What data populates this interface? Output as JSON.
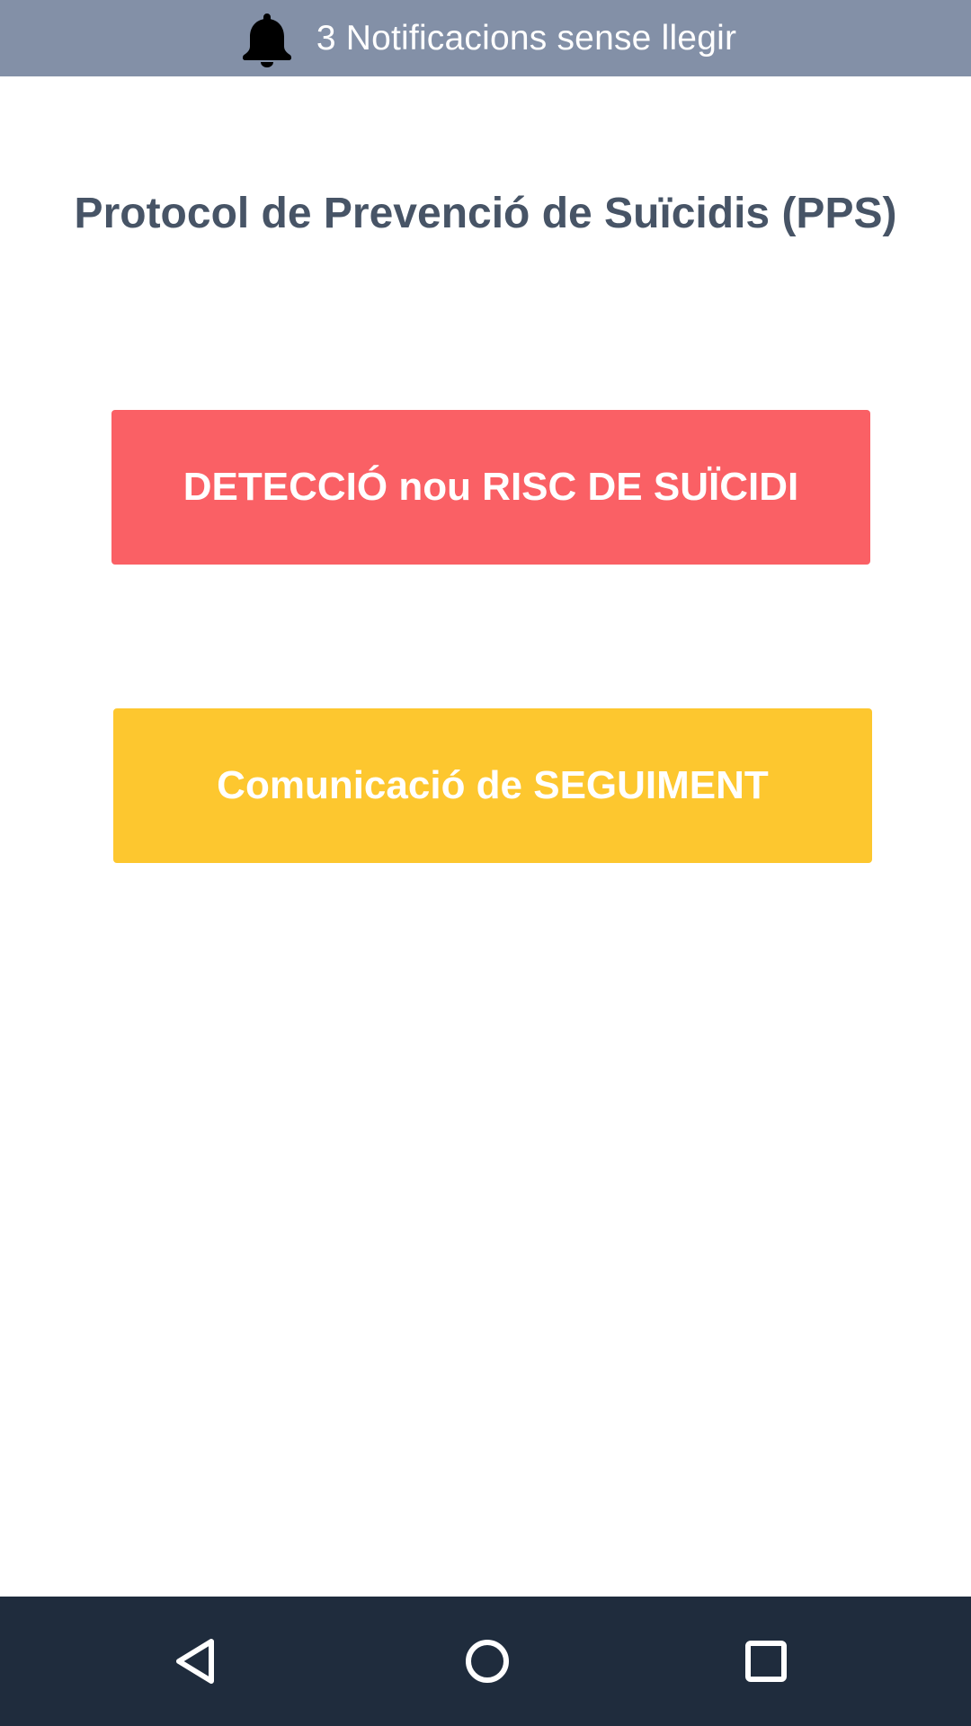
{
  "notification_bar": {
    "icon": "bell-icon",
    "text": "3 Notificacions sense llegir",
    "background": "#8390a7"
  },
  "page": {
    "title": "Protocol de Prevenció de Suïcidis (PPS)",
    "title_color": "#475466"
  },
  "actions": {
    "detect": {
      "label": "DETECCIÓ nou RISC DE SUÏCIDI",
      "color": "#fa6065"
    },
    "follow_up": {
      "label": "Comunicació de SEGUIMENT",
      "color": "#fdc72f"
    }
  },
  "system_nav": {
    "background": "#1f2c3d",
    "buttons": [
      {
        "icon": "back-icon"
      },
      {
        "icon": "home-icon"
      },
      {
        "icon": "recents-icon"
      }
    ]
  }
}
